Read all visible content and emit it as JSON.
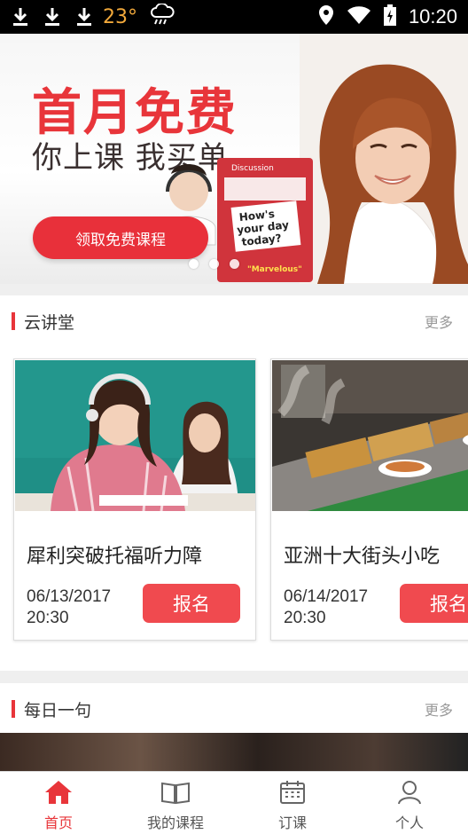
{
  "statusbar": {
    "temperature": "23°",
    "time": "10:20",
    "icons": [
      "download-icon",
      "download-icon",
      "download-icon",
      "cloud-rain-icon",
      "location-icon",
      "wifi-icon",
      "battery-icon"
    ]
  },
  "banner": {
    "title": "首月免费",
    "subtitle": "你上课 我买单",
    "cta_label": "领取免费课程",
    "art_text": {
      "card_line1": "How's",
      "card_line2": "your day",
      "card_line3": "today?",
      "card_header": "Discussion",
      "answer": "\"Marvelous\""
    },
    "slide_count": 3,
    "active_slide": 0
  },
  "section_lecture": {
    "title": "云讲堂",
    "more_label": "更多"
  },
  "courses": [
    {
      "title": "犀利突破托福听力障",
      "date": "06/13/2017",
      "time": "20:30",
      "button_label": "报名"
    },
    {
      "title": "亚洲十大街头小吃",
      "date": "06/14/2017",
      "time": "20:30",
      "button_label": "报名"
    }
  ],
  "section_daily": {
    "title": "每日一句",
    "more_label": "更多"
  },
  "tabbar": {
    "items": [
      {
        "label": "首页",
        "icon": "home-icon",
        "active": true
      },
      {
        "label": "我的课程",
        "icon": "book-icon",
        "active": false
      },
      {
        "label": "订课",
        "icon": "calendar-icon",
        "active": false
      },
      {
        "label": "个人",
        "icon": "person-icon",
        "active": false
      }
    ]
  },
  "colors": {
    "accent": "#e8353a",
    "button": "#f04a4f",
    "weather": "#f2a93b"
  }
}
